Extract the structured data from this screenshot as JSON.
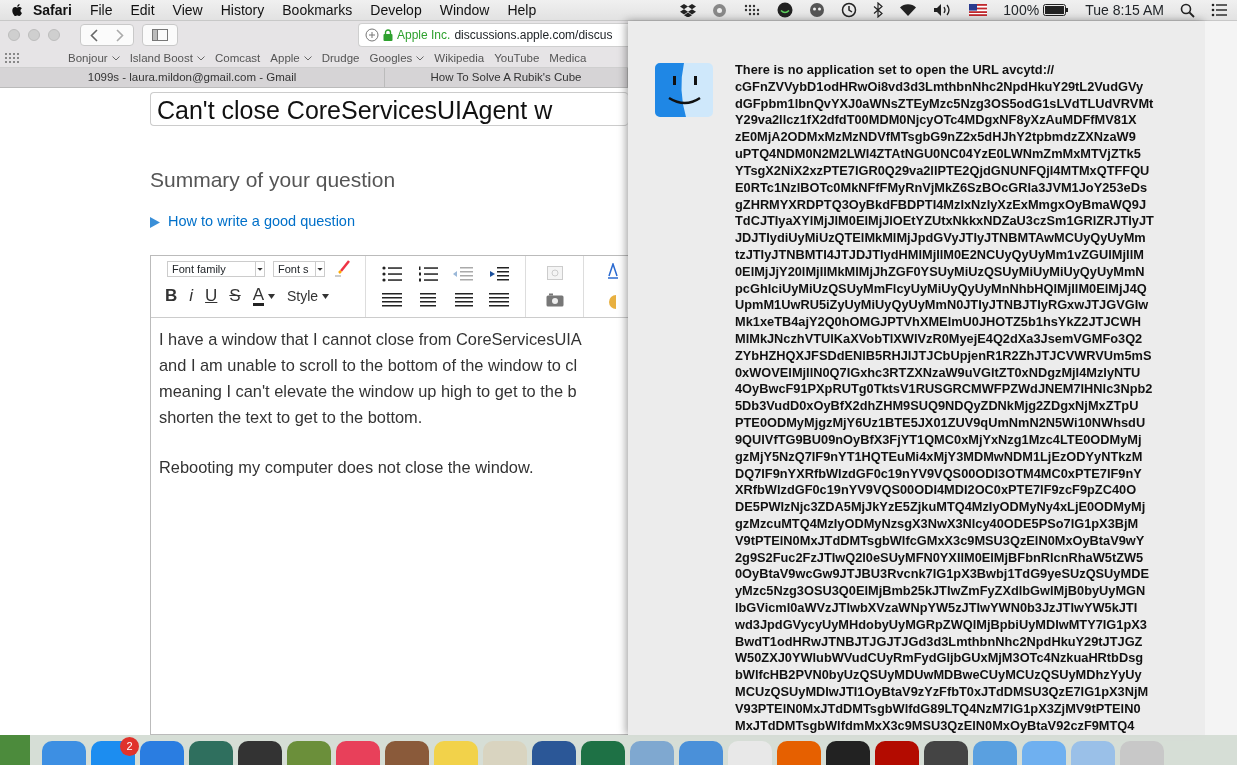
{
  "menu_bar": {
    "app": "Safari",
    "menus": [
      "File",
      "Edit",
      "View",
      "History",
      "Bookmarks",
      "Develop",
      "Window",
      "Help"
    ],
    "battery": "100%",
    "clock": "Tue 8:15 AM"
  },
  "browser": {
    "address": {
      "owner": "Apple Inc.",
      "url": "discussions.apple.com/discus"
    },
    "bookmarks": [
      {
        "label": "Bonjour",
        "menu": true
      },
      {
        "label": "Island Boost",
        "menu": true
      },
      {
        "label": "Comcast",
        "menu": false
      },
      {
        "label": "Apple",
        "menu": true
      },
      {
        "label": "Drudge",
        "menu": false
      },
      {
        "label": "Googles",
        "menu": true
      },
      {
        "label": "Wikipedia",
        "menu": false
      },
      {
        "label": "YouTube",
        "menu": false
      },
      {
        "label": "Medica",
        "menu": false
      }
    ],
    "tabs": [
      {
        "label": "1099s - laura.mildon@gmail.com - Gmail",
        "selected": false
      },
      {
        "label": "How To Solve A Rubik's Cube",
        "selected": false
      }
    ]
  },
  "page": {
    "title_value": "Can't close CoreServicesUIAgent w",
    "summary_heading": "Summary of your question",
    "help_link": "How to write a good question",
    "editor": {
      "font_family": "Font family",
      "font_size": "Font s",
      "format_buttons": [
        "B",
        "i",
        "U",
        "S"
      ],
      "color_button": "A",
      "style": "Style",
      "paragraphs": [
        [
          "I have a window that I cannot close from CoreServicesUIA",
          "and I am unable to scroll to the bottom of the window to cl",
          "meaning I can't elevate the window up high to get to the b",
          "shorten the text to get to the bottom."
        ],
        [
          "Rebooting my computer does not close the window."
        ]
      ]
    }
  },
  "dialog": {
    "message_lines": [
      "There is no application set to open the URL avcytd://",
      "cGFnZVVybD1odHRwOi8vd3d3LmthbnNhc2NpdHkuY29tL2VudGVy",
      "dGFpbm1lbnQvYXJ0aWNsZTEyMzc5Nzg3OS5odG1sLVdTLUdVRVMt",
      "Y29va2llcz1fX2dfdT00MDM0NjcyOTc4MDgxNF8yXzAuMDFfMV81X",
      "zE0MjA2ODMxMzMzNDVfMTsgbG9nZ2x5dHJhY2tpbmdzZXNzaW9",
      "uPTQ4NDM0N2M2LWI4ZTAtNGU0NC04YzE0LWNmZmMxMTVjZTk5",
      "YTsgX2NiX2xzPTE7IGR0Q29va2llPTE2QjdGNUNFQjI4MTMxQTFFQU",
      "E0RTc1NzlBOTc0MkNFfFMyRnVjMkZ6SzBOcGRla3JVM1JoY253eDs",
      "gZHRMYXRDPTQ3OyBkdFBDPTI4MzIxNzIyXzExMmgxOyBmaWQ9J",
      "TdCJTIyaXYlMjJlM0ElMjJlOEtYZUtxNkkxNDZaU3czSm1GRlZRJTIyJT",
      "JDJTIydiUyMiUzQTElMkMlMjJpdGVyJTIyJTNBMTAwMCUyQyUyMm",
      "tzJTIyJTNBMTI4JTJDJTIydHMlMjIlM0E2NCUyQyUyMm1vZGUlMjIlM",
      "0ElMjJjY20lMjIlMkMlMjJhZGF0YSUyMiUzQSUyMiUyMiUyQyUyMmN",
      "pcGhlciUyMiUzQSUyMmFlcyUyMiUyQyUyMnNhbHQlMjIlM0ElMjJ4Q",
      "UpmM1UwRU5iZyUyMiUyQyUyMmN0JTIyJTNBJTIyRGxwJTJGVGIw",
      "Mk1xeTB4ajY2Q0hOMGJPTVhXMElmU0JHOTZ5b1hsYkZ2JTJCWH",
      "MlMkJNczhVTUlKaXVobTlXWlVzR0MyejE4Q2dXa3JsemVGMFo3Q2",
      "ZYbHZHQXJFSDdENlB5RHJlJTJCbUpjenR1R2ZhJTJCVWRVUm5mS",
      "0xWOVElMjIlN0Q7IGxhc3RTZXNzaW9uVGltZT0xNDgzMjI4MzIyNTU",
      "4OyBwcF91PXpRUTg0TktsV1RUSGRCMWFPZWdJNEM7IHNlc3Npb2",
      "5Db3VudD0xOyBfX2dhZHM9SUQ9NDQyZDNkMjg2ZDgxNjMxZTpU",
      "PTE0ODMyMjgzMjY6Uz1BTE5JX01ZUV9qUmNmN2N5Wi10NWhsdU",
      "9QUlVfTG9BU09nOyBfX3FjYT1QMC0xMjYxNzg1Mzc4LTE0ODMyMj",
      "gzMjY5NzQ7IF9nYT1HQTEuMi4xMjY3MDMwNDM1LjEzODYyNTkzM",
      "DQ7IF9nYXRfbWlzdGF0c19nYV9VQS00ODI3OTM4MC0xPTE7IF9nY",
      "XRfbWlzdGF0c19nYV9VQS00ODI4MDI2OC0xPTE7IF9zcF9pZC40O",
      "DE5PWIzNjc3ZDA5MjJkYzE5ZjkuMTQ4MzIyODMyNy4xLjE0ODMyMj",
      "gzMzcuMTQ4MzIyODMyNzsgX3NwX3Nlcy40ODE5PSo7IG1pX3BjM",
      "V9tPTElN0MxJTdDMTsgbWlfcGMxX3c9MSU3QzElN0MxOyBtaV9wY",
      "2g9S2Fuc2FzJTIwQ2l0eSUyMFN0YXIlM0ElMjBFbnRlcnRhaW5tZW5",
      "0OyBtaV9wcGw9JTJBU3Rvcnk7IG1pX3Bwbj1TdG9yeSUzQSUyMDE",
      "yMzc5Nzg3OSU3Q0ElMjBmb25kJTIwZmFyZXdlbGwlMjB0byUyMGN",
      "lbGVicml0aWVzJTIwbXVzaWNpYW5zJTIwYWN0b3JzJTIwYW5kJTI",
      "wd3JpdGVycyUyMHdobyUyMGRpZWQlMjBpbiUyMDIwMTY7IG1pX3",
      "BwdT1odHRwJTNBJTJGJTJGd3d3LmthbnNhc2NpdHkuY29tJTJGZ",
      "W50ZXJ0YWlubWVudCUyRmFydGljbGUxMjM3OTc4NzkuaHRtbDsg",
      "bWlfcHB2PVN0byUzQSUyMDUwMDBweCUyMCUzQSUyMDhzYyUy",
      "MCUzQSUyMDIwJTI1OyBtaV9zYzFfbT0xJTdDMSU3QzE7IG1pX3NjM",
      "V93PTElN0MxJTdDMTsgbWlfdG89LTQ4NzM7IG1pX3ZjMV9tPTElN0",
      "MxJTdDMTsgbWlfdmMxX3c9MSU3QzElN0MxOyBtaV92czF9MTQ4"
    ]
  },
  "dock": {
    "apps": [
      {
        "color": "#3d8fe3"
      },
      {
        "color": "#1c8df0",
        "badge": "2"
      },
      {
        "color": "#2a7de1"
      },
      {
        "color": "#2f6f5e"
      },
      {
        "color": "#333333"
      },
      {
        "color": "#6b8f3a"
      },
      {
        "color": "#e8405a"
      },
      {
        "color": "#8a5a3a"
      },
      {
        "color": "#f2d24a"
      },
      {
        "color": "#d9d4c0"
      },
      {
        "color": "#2b5797"
      },
      {
        "color": "#1e7145"
      },
      {
        "color": "#7fa8d0"
      },
      {
        "color": "#4a90d9"
      },
      {
        "color": "#e8e8e8"
      },
      {
        "color": "#e66000"
      },
      {
        "color": "#222222"
      },
      {
        "color": "#b30b00"
      },
      {
        "color": "#444444"
      },
      {
        "color": "#5aa0e0"
      },
      {
        "color": "#6fb0f0"
      },
      {
        "color": "#9ac0e8"
      },
      {
        "color": "#c8c8c8"
      }
    ]
  }
}
